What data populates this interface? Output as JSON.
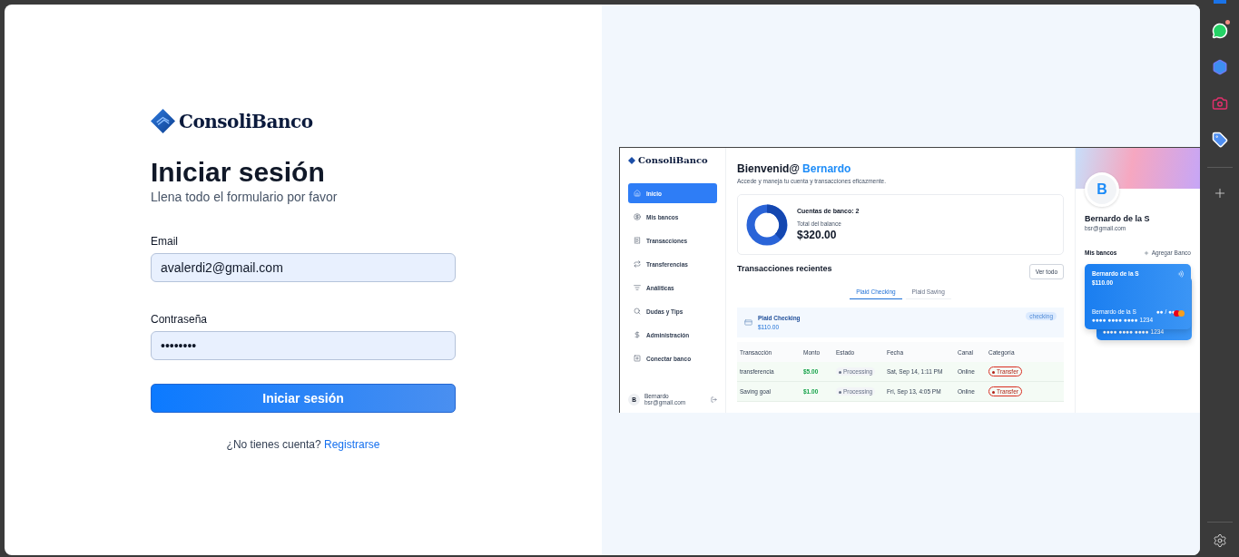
{
  "login": {
    "brand": "ConsoliBanco",
    "title": "Iniciar sesión",
    "subtitle": "Llena todo el formulario por favor",
    "fields": [
      {
        "label": "Email",
        "value": "avalerdi2@gmail.com"
      },
      {
        "label": "Contraseña",
        "value": "••••••••"
      }
    ],
    "submit": "Iniciar sesión",
    "signup_prompt": "¿No tienes cuenta?",
    "signup_link": "Registrarse"
  },
  "preview": {
    "brand": "ConsoliBanco",
    "nav": [
      {
        "label": "Inicio",
        "selected": true
      },
      {
        "label": "Mis bancos",
        "selected": false
      },
      {
        "label": "Transacciones",
        "selected": false
      },
      {
        "label": "Transferencias",
        "selected": false
      },
      {
        "label": "Análiticas",
        "selected": false
      },
      {
        "label": "Dudas y Tips",
        "selected": false
      },
      {
        "label": "Administración",
        "selected": false
      },
      {
        "label": "Conectar banco",
        "selected": false
      }
    ],
    "user": {
      "initial": "B",
      "name": "Bernardo",
      "email": "bsr@gmail.com"
    },
    "greeting": "Bienvenid@",
    "greeting_name": "Bernardo",
    "intro": "Accede y maneja tu cuenta y transacciones eficazmente.",
    "balance": {
      "accounts": "Cuentas de banco: 2",
      "label": "Total del balance",
      "amount": "$320.00"
    },
    "recent_title": "Transacciones recientes",
    "view_all": "Ver todo",
    "tabs": [
      {
        "label": "Plaid Checking",
        "selected": true
      },
      {
        "label": "Plaid Saving",
        "selected": false
      }
    ],
    "account": {
      "name": "Plaid Checking",
      "amount": "$110.00",
      "badge": "checking"
    },
    "columns": [
      "Transacción",
      "Monto",
      "Estado",
      "Fecha",
      "Canal",
      "Categoría"
    ],
    "rows": [
      {
        "name": "transferencia",
        "amount": "$5.00",
        "status": "Processing",
        "date": "Sat, Sep 14, 1:11 PM",
        "channel": "Online",
        "category": "Transfer"
      },
      {
        "name": "Saving goal",
        "amount": "$1.00",
        "status": "Processing",
        "date": "Fri, Sep 13, 4:05 PM",
        "channel": "Online",
        "category": "Transfer"
      }
    ],
    "profile": {
      "initial": "B",
      "name": "Bernardo de la S",
      "email": "bsr@gmail.com"
    },
    "banks_title": "Mis bancos",
    "add_bank": "Agregar Banco",
    "card": {
      "holder": "Bernardo de la S",
      "balance": "$110.00",
      "name_line": "Bernardo de la S",
      "expiry": "●● / ●●",
      "number": "●●●● ●●●● ●●●● 1234"
    },
    "back_card_number": "●●●● ●●●● ●●●● 1234"
  },
  "dock": [
    {
      "notify": true
    },
    {
      "notify": false
    },
    {
      "notify": false
    },
    {
      "notify": false
    }
  ]
}
